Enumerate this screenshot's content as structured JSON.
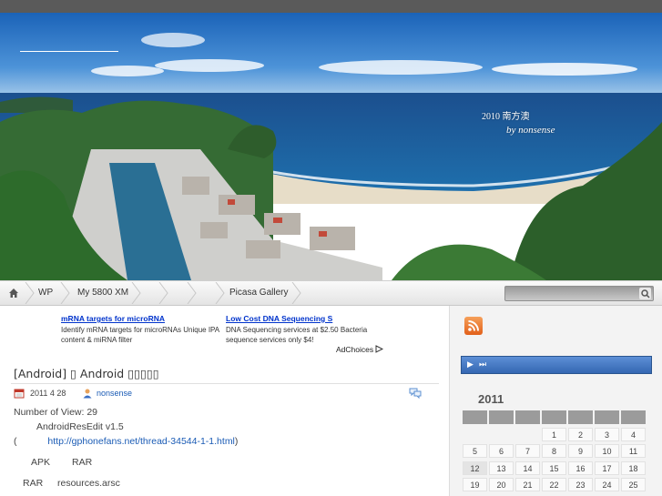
{
  "banner": {
    "year_title": "2010 南方澳",
    "byline": "by nonsense"
  },
  "nav": {
    "home_icon": "home-icon",
    "items": [
      "WP",
      "My 5800 XM",
      "",
      "",
      "",
      "Picasa Gallery"
    ],
    "search_placeholder": ""
  },
  "ads": [
    {
      "title": "mRNA targets for microRNA",
      "text": "Identify mRNA targets for microRNAs Unique IPA content & miRNA filter"
    },
    {
      "title": "Low Cost DNA Sequencing S",
      "text": "DNA Sequencing services at $2.50 Bacteria sequence services only $4!"
    }
  ],
  "adchoices": "AdChoices",
  "post": {
    "title": "[Android] ▯ Android ▯▯▯▯▯",
    "date": "2011 4 28",
    "author": "nonsense",
    "views": "Number of View: 29",
    "tool": "AndroidResEdit v1.5",
    "paren_open": "(",
    "url": "http://gphonefans.net/thread-34544-1-1.html",
    "paren_close": ")",
    "line_apk_a": "APK",
    "line_apk_b": "RAR",
    "line_rar_a": "RAR",
    "line_rar_b": "resources.arsc"
  },
  "sidebar": {
    "rss_icon": "rss-icon",
    "player_play": "▶",
    "player_next": "⏭",
    "calendar_year": "2011",
    "calendar_rows": [
      [
        "",
        "",
        "",
        "1",
        "2",
        "3",
        "4"
      ],
      [
        "5",
        "6",
        "7",
        "8",
        "9",
        "10",
        "11"
      ],
      [
        "12",
        "13",
        "14",
        "15",
        "16",
        "17",
        "18"
      ],
      [
        "19",
        "20",
        "21",
        "22",
        "23",
        "24",
        "25"
      ]
    ]
  },
  "colors": {
    "link": "#1a5bb5",
    "ad_title": "#0033cc",
    "player": "#3a6bb8",
    "topbar": "#5a5a5a"
  }
}
